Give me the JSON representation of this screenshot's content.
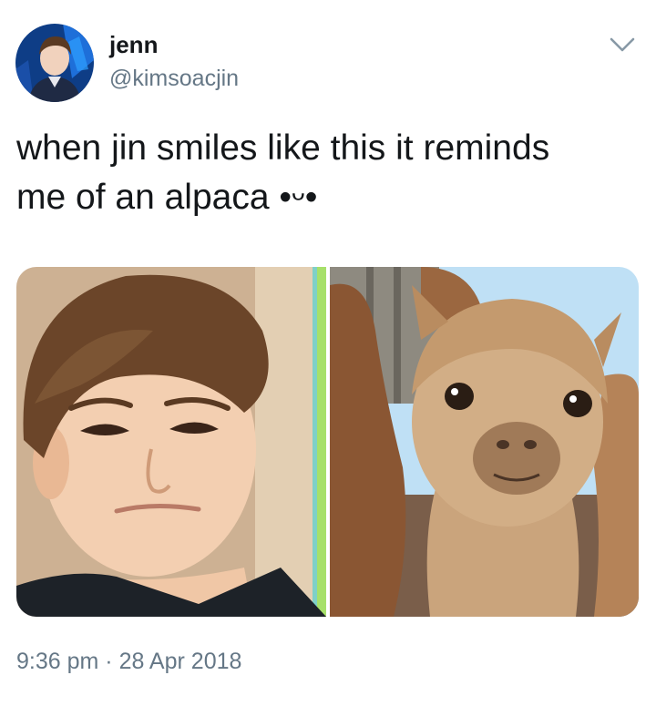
{
  "user": {
    "display_name": "jenn",
    "handle": "@kimsoacjin"
  },
  "tweet": {
    "text": "when jin smiles like this it reminds\nme of an alpaca •ᵕ•"
  },
  "meta": {
    "time": "9:36 pm",
    "separator": " · ",
    "date": "28 Apr 2018"
  },
  "icons": {
    "menu": "chevron-down-icon"
  },
  "colors": {
    "text": "#14171a",
    "secondary": "#657786"
  }
}
